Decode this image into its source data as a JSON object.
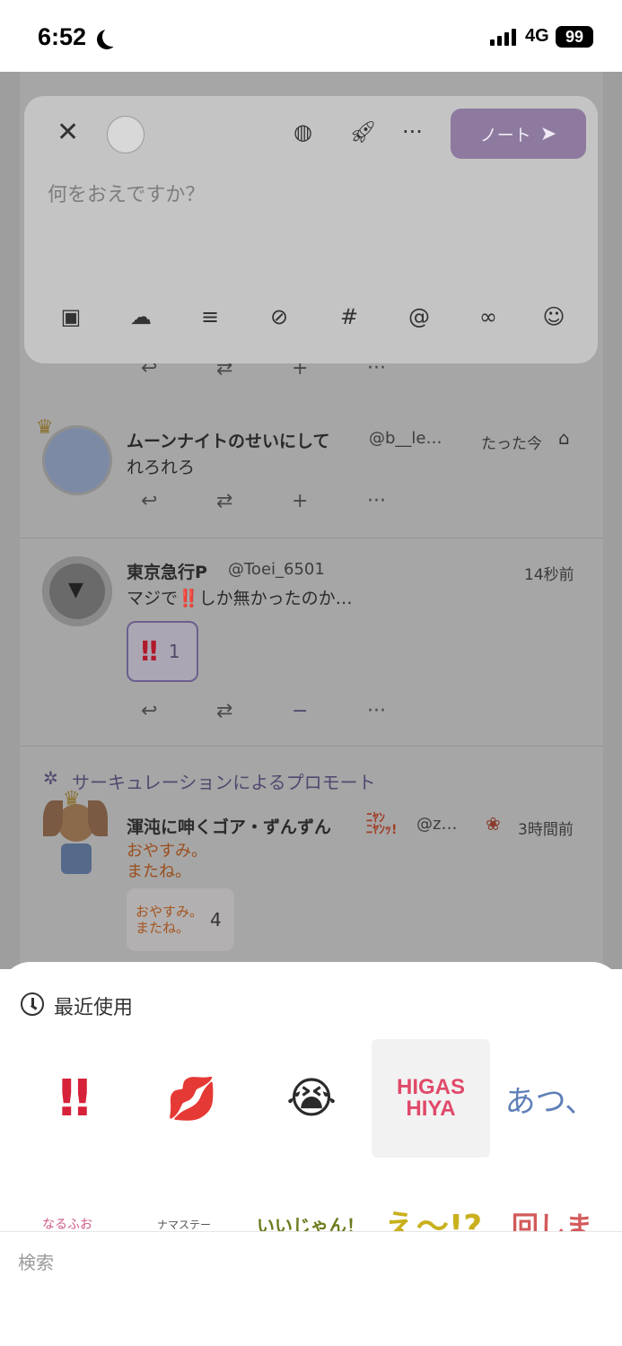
{
  "status": {
    "time": "6:52",
    "network": "4G",
    "battery": "99"
  },
  "composer": {
    "placeholder": "何をおえですか？",
    "post_label": "ノート",
    "icons": [
      "close-icon",
      "globe-icon",
      "rocket-icon",
      "more-icon",
      "send-icon"
    ],
    "tool_icons": [
      "image-add-icon",
      "cloud-download-icon",
      "poll-icon",
      "hide-icon",
      "hashtag-icon",
      "mention-icon",
      "glasses-icon",
      "emoji-icon"
    ]
  },
  "notes": [
    {
      "name": "ムーンナイトのせいにして",
      "handle": "@b__le…",
      "time": "たった今",
      "text": "れろれろ"
    },
    {
      "name": "東京急行P",
      "handle": "@Toei_6501",
      "time": "14秒前",
      "text": "マジで‼️しか無かったのか…",
      "reaction_emoji": "‼",
      "reaction_count": "1"
    },
    {
      "promo_label": "サーキュレーションによるプロモート",
      "name": "渾沌に呻くゴア・ずんずん",
      "handle": "@z…",
      "time": "3時間前",
      "text_line1": "おやすみ。",
      "text_line2": "またね。",
      "reaction_text1": "おやすみ。",
      "reaction_text2": "またね。",
      "reaction_count": "4"
    }
  ],
  "picker": {
    "recent_label": "最近使用",
    "recent": [
      "‼",
      "💋",
      "😭",
      "HIGAS HIYA",
      "あつ、"
    ],
    "row2": [
      "なるふお",
      "ナマステー",
      "いいじゃん！",
      "え〜!?",
      "回しま"
    ],
    "search_placeholder": "検索"
  },
  "colors": {
    "accent": "#8d7a9e",
    "reaction_red": "#d6223a",
    "promo_text": "#52486f",
    "higashiya": "#e04a6a"
  }
}
